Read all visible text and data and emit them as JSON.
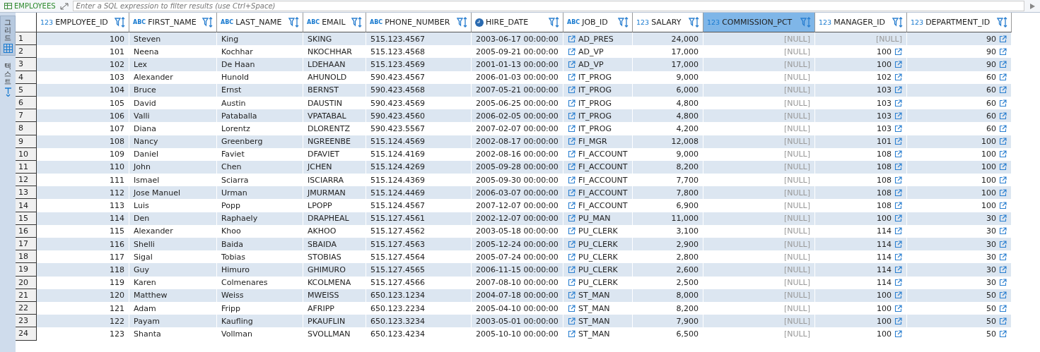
{
  "toolbar": {
    "table_name": "EMPLOYEES",
    "filter": {
      "placeholder": "Enter a SQL expression to filter results (use Ctrl+Space)"
    }
  },
  "side_tabs": [
    {
      "label": "그리드",
      "kind": "grid",
      "selected": true
    },
    {
      "label": "텍스트",
      "kind": "text",
      "selected": false
    }
  ],
  "columns": [
    {
      "name": "EMPLOYEE_ID",
      "kind": "number",
      "type_label": "123",
      "link": false,
      "selected": false
    },
    {
      "name": "FIRST_NAME",
      "kind": "text",
      "type_label": "ABC",
      "link": false,
      "selected": false
    },
    {
      "name": "LAST_NAME",
      "kind": "text",
      "type_label": "ABC",
      "link": false,
      "selected": false
    },
    {
      "name": "EMAIL",
      "kind": "text",
      "type_label": "ABC",
      "link": false,
      "selected": false
    },
    {
      "name": "PHONE_NUMBER",
      "kind": "text",
      "type_label": "ABC",
      "link": false,
      "selected": false
    },
    {
      "name": "HIRE_DATE",
      "kind": "date",
      "link": false,
      "selected": false
    },
    {
      "name": "JOB_ID",
      "kind": "text",
      "type_label": "ABC",
      "link": true,
      "selected": false
    },
    {
      "name": "SALARY",
      "kind": "number",
      "type_label": "123",
      "link": false,
      "selected": false
    },
    {
      "name": "COMMISSION_PCT",
      "kind": "number",
      "type_label": "123",
      "selected": true
    },
    {
      "name": "MANAGER_ID",
      "kind": "number",
      "type_label": "123",
      "link": true,
      "selected": false
    },
    {
      "name": "DEPARTMENT_ID",
      "kind": "number",
      "type_label": "123",
      "link": true,
      "selected": false
    }
  ],
  "rows": [
    {
      "num": "1",
      "cells": [
        "100",
        "Steven",
        "King",
        "SKING",
        "515.123.4567",
        "2003-06-17 00:00:00",
        "AD_PRES",
        "24,000",
        {
          "text": "[NULL]",
          "null": true
        },
        {
          "text": "[NULL]",
          "null": true
        },
        "90"
      ]
    },
    {
      "num": "2",
      "cells": [
        "101",
        "Neena",
        "Kochhar",
        "NKOCHHAR",
        "515.123.4568",
        "2005-09-21 00:00:00",
        "AD_VP",
        "17,000",
        {
          "text": "[NULL]",
          "null": true
        },
        "100",
        "90"
      ]
    },
    {
      "num": "3",
      "cells": [
        "102",
        "Lex",
        "De Haan",
        "LDEHAAN",
        "515.123.4569",
        "2001-01-13 00:00:00",
        "AD_VP",
        "17,000",
        {
          "text": "[NULL]",
          "null": true
        },
        "100",
        "90"
      ]
    },
    {
      "num": "4",
      "cells": [
        "103",
        "Alexander",
        "Hunold",
        "AHUNOLD",
        "590.423.4567",
        "2006-01-03 00:00:00",
        "IT_PROG",
        "9,000",
        {
          "text": "[NULL]",
          "null": true
        },
        "102",
        "60"
      ]
    },
    {
      "num": "5",
      "cells": [
        "104",
        "Bruce",
        "Ernst",
        "BERNST",
        "590.423.4568",
        "2007-05-21 00:00:00",
        "IT_PROG",
        "6,000",
        {
          "text": "[NULL]",
          "null": true
        },
        "103",
        "60"
      ]
    },
    {
      "num": "6",
      "cells": [
        "105",
        "David",
        "Austin",
        "DAUSTIN",
        "590.423.4569",
        "2005-06-25 00:00:00",
        "IT_PROG",
        "4,800",
        {
          "text": "[NULL]",
          "null": true
        },
        "103",
        "60"
      ]
    },
    {
      "num": "7",
      "cells": [
        "106",
        "Valli",
        "Pataballa",
        "VPATABAL",
        "590.423.4560",
        "2006-02-05 00:00:00",
        "IT_PROG",
        "4,800",
        {
          "text": "[NULL]",
          "null": true
        },
        "103",
        "60"
      ]
    },
    {
      "num": "8",
      "cells": [
        "107",
        "Diana",
        "Lorentz",
        "DLORENTZ",
        "590.423.5567",
        "2007-02-07 00:00:00",
        "IT_PROG",
        "4,200",
        {
          "text": "[NULL]",
          "null": true
        },
        "103",
        "60"
      ]
    },
    {
      "num": "9",
      "cells": [
        "108",
        "Nancy",
        "Greenberg",
        "NGREENBE",
        "515.124.4569",
        "2002-08-17 00:00:00",
        "FI_MGR",
        "12,008",
        {
          "text": "[NULL]",
          "null": true
        },
        "101",
        "100"
      ]
    },
    {
      "num": "10",
      "cells": [
        "109",
        "Daniel",
        "Faviet",
        "DFAVIET",
        "515.124.4169",
        "2002-08-16 00:00:00",
        "FI_ACCOUNT",
        "9,000",
        {
          "text": "[NULL]",
          "null": true
        },
        "108",
        "100"
      ]
    },
    {
      "num": "11",
      "cells": [
        "110",
        "John",
        "Chen",
        "JCHEN",
        "515.124.4269",
        "2005-09-28 00:00:00",
        "FI_ACCOUNT",
        "8,200",
        {
          "text": "[NULL]",
          "null": true
        },
        "108",
        "100"
      ]
    },
    {
      "num": "12",
      "cells": [
        "111",
        "Ismael",
        "Sciarra",
        "ISCIARRA",
        "515.124.4369",
        "2005-09-30 00:00:00",
        "FI_ACCOUNT",
        "7,700",
        {
          "text": "[NULL]",
          "null": true
        },
        "108",
        "100"
      ]
    },
    {
      "num": "13",
      "cells": [
        "112",
        "Jose Manuel",
        "Urman",
        "JMURMAN",
        "515.124.4469",
        "2006-03-07 00:00:00",
        "FI_ACCOUNT",
        "7,800",
        {
          "text": "[NULL]",
          "null": true
        },
        "108",
        "100"
      ]
    },
    {
      "num": "14",
      "cells": [
        "113",
        "Luis",
        "Popp",
        "LPOPP",
        "515.124.4567",
        "2007-12-07 00:00:00",
        "FI_ACCOUNT",
        "6,900",
        {
          "text": "[NULL]",
          "null": true
        },
        "108",
        "100"
      ]
    },
    {
      "num": "15",
      "cells": [
        "114",
        "Den",
        "Raphaely",
        "DRAPHEAL",
        "515.127.4561",
        "2002-12-07 00:00:00",
        "PU_MAN",
        "11,000",
        {
          "text": "[NULL]",
          "null": true
        },
        "100",
        "30"
      ]
    },
    {
      "num": "16",
      "cells": [
        "115",
        "Alexander",
        "Khoo",
        "AKHOO",
        "515.127.4562",
        "2003-05-18 00:00:00",
        "PU_CLERK",
        "3,100",
        {
          "text": "[NULL]",
          "null": true
        },
        "114",
        "30"
      ]
    },
    {
      "num": "17",
      "cells": [
        "116",
        "Shelli",
        "Baida",
        "SBAIDA",
        "515.127.4563",
        "2005-12-24 00:00:00",
        "PU_CLERK",
        "2,900",
        {
          "text": "[NULL]",
          "null": true
        },
        "114",
        "30"
      ]
    },
    {
      "num": "18",
      "cells": [
        "117",
        "Sigal",
        "Tobias",
        "STOBIAS",
        "515.127.4564",
        "2005-07-24 00:00:00",
        "PU_CLERK",
        "2,800",
        {
          "text": "[NULL]",
          "null": true
        },
        "114",
        "30"
      ]
    },
    {
      "num": "19",
      "cells": [
        "118",
        "Guy",
        "Himuro",
        "GHIMURO",
        "515.127.4565",
        "2006-11-15 00:00:00",
        "PU_CLERK",
        "2,600",
        {
          "text": "[NULL]",
          "null": true
        },
        "114",
        "30"
      ]
    },
    {
      "num": "20",
      "cells": [
        "119",
        "Karen",
        "Colmenares",
        "KCOLMENA",
        "515.127.4566",
        "2007-08-10 00:00:00",
        "PU_CLERK",
        "2,500",
        {
          "text": "[NULL]",
          "null": true
        },
        "114",
        "30"
      ]
    },
    {
      "num": "21",
      "cells": [
        "120",
        "Matthew",
        "Weiss",
        "MWEISS",
        "650.123.1234",
        "2004-07-18 00:00:00",
        "ST_MAN",
        "8,000",
        {
          "text": "[NULL]",
          "null": true
        },
        "100",
        "50"
      ]
    },
    {
      "num": "22",
      "cells": [
        "121",
        "Adam",
        "Fripp",
        "AFRIPP",
        "650.123.2234",
        "2005-04-10 00:00:00",
        "ST_MAN",
        "8,200",
        {
          "text": "[NULL]",
          "null": true
        },
        "100",
        "50"
      ]
    },
    {
      "num": "23",
      "cells": [
        "122",
        "Payam",
        "Kaufling",
        "PKAUFLIN",
        "650.123.3234",
        "2003-05-01 00:00:00",
        "ST_MAN",
        "7,900",
        {
          "text": "[NULL]",
          "null": true
        },
        "100",
        "50"
      ]
    },
    {
      "num": "24",
      "cells": [
        "123",
        "Shanta",
        "Vollman",
        "SVOLLMAN",
        "650.123.4234",
        "2005-10-10 00:00:00",
        "ST_MAN",
        "6,500",
        {
          "text": "[NULL]",
          "null": true
        },
        "100",
        "50"
      ]
    }
  ]
}
